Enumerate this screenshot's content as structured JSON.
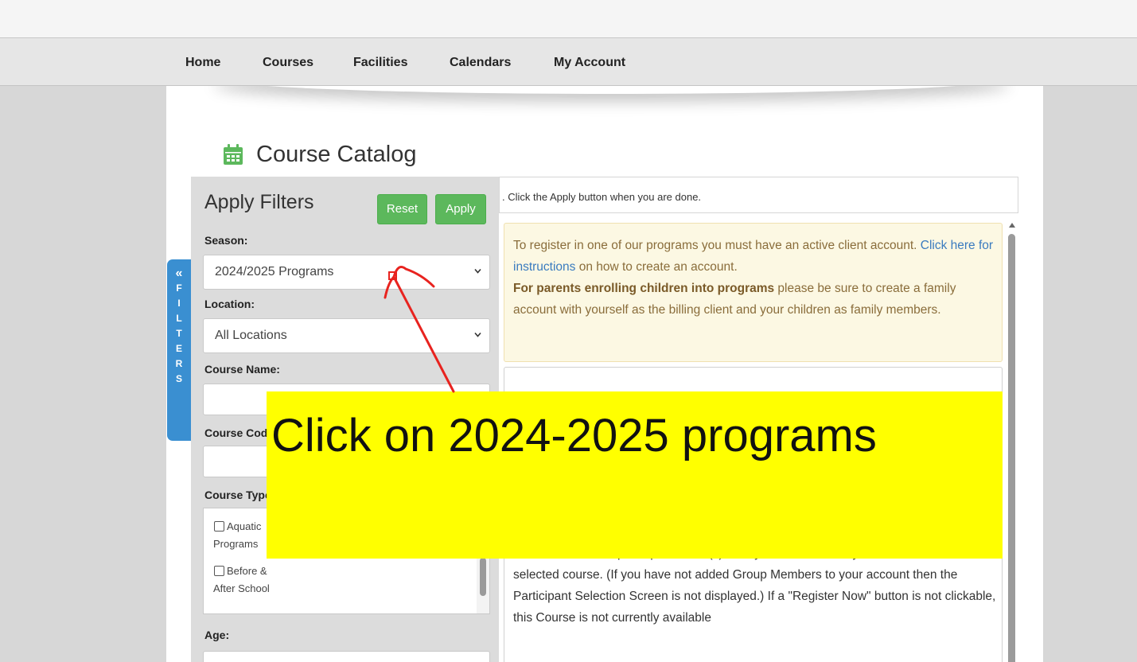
{
  "nav": {
    "items": [
      {
        "label": "Home"
      },
      {
        "label": "Courses"
      },
      {
        "label": "Facilities"
      },
      {
        "label": "Calendars"
      },
      {
        "label": "My Account"
      }
    ]
  },
  "page": {
    "title": "Course Catalog",
    "icon": "calendar-icon",
    "icon_color": "#5cb85c"
  },
  "filters": {
    "title": "Apply Filters",
    "reset_label": "Reset",
    "apply_label": "Apply",
    "season_label": "Season:",
    "season_value": "2024/2025 Programs",
    "location_label": "Location:",
    "location_value": "All Locations",
    "course_name_label": "Course Name:",
    "course_code_label": "Course Code:",
    "course_type_label": "Course Type:",
    "course_types": [
      {
        "line1": "Aquatic",
        "line2": "Programs"
      },
      {
        "line1": "Before &",
        "line2": "After School"
      }
    ],
    "age_label": "Age:",
    "tab_letters": [
      "«",
      "F",
      "I",
      "L",
      "T",
      "E",
      "R",
      "S"
    ],
    "tab_color": "#3a8fd1",
    "button_color": "#5cb85c"
  },
  "info": {
    "text": ". Click the Apply button when you are done."
  },
  "notice": {
    "part1": "To register in one of our programs you must have an active client account. ",
    "link": "Click here for instructions",
    "part2": " on how to create an account.",
    "bold": "For parents enrolling children into programs",
    "part3": " please be sure to create a family account with yourself as the billing client and your children as family members."
  },
  "panel": {
    "text": "Screen. Select the participant name(s) from your account that you wish to enroll into the selected course. (If you have not added Group Members to your account then the Participant Selection Screen is not displayed.) If a \"Register Now\" button is not clickable, this Course is not currently available"
  },
  "overlay": {
    "text": "Click on 2024-2025 programs",
    "color": "#ffff00",
    "arrow_color": "#e8231f"
  }
}
